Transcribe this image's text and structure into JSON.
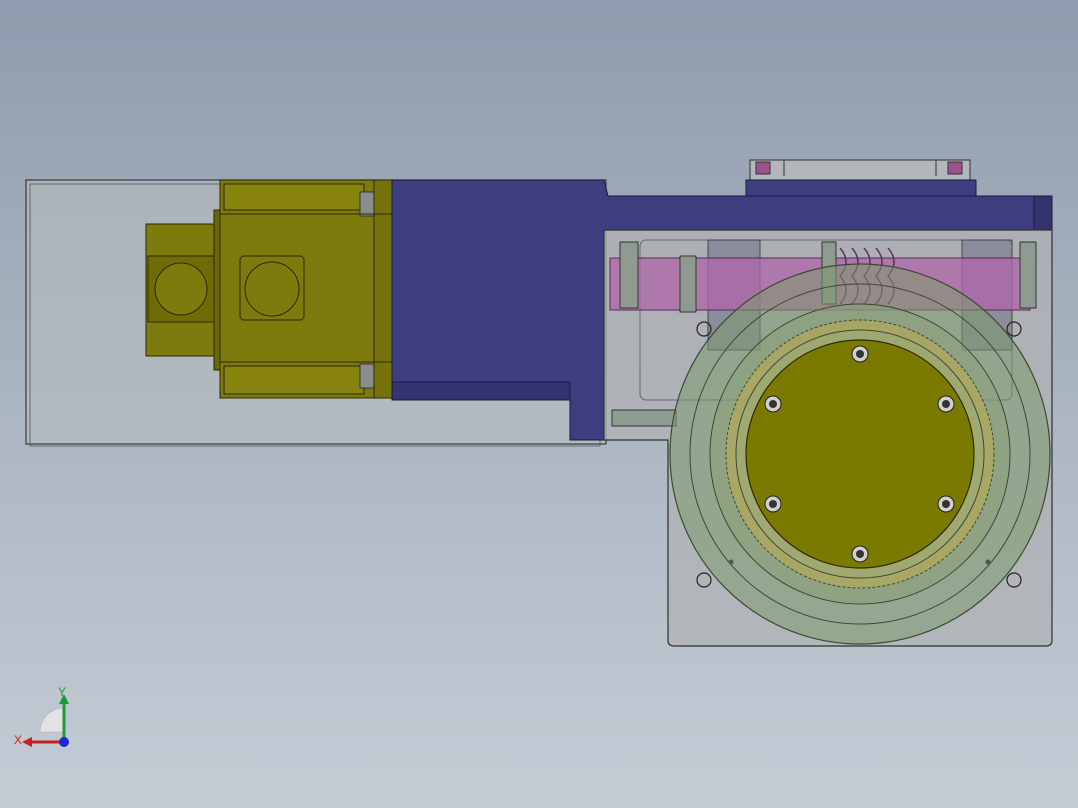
{
  "viewport": {
    "background_top": "#8e9cad",
    "background_bottom": "#c4ccd4"
  },
  "model": {
    "housing_color": "#a8a8a8",
    "motor_color": "#7d7a0e",
    "adapter_color": "#3e3d80",
    "worm_color": "#b066a8",
    "wheel_ring_color": "#7e9a6e",
    "output_flange_color": "#7a7a00"
  },
  "triad": {
    "x_label": "X",
    "y_label": "Y",
    "x_color": "#c81e1e",
    "y_color": "#1e9a3a",
    "z_color": "#1e2ad0"
  }
}
